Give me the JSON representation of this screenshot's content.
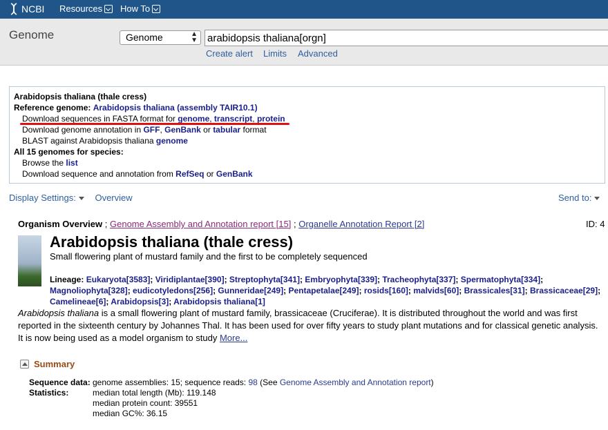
{
  "topbar": {
    "logo_text": "NCBI",
    "resources": "Resources",
    "howto": "How To"
  },
  "search": {
    "db_title": "Genome",
    "db_select": "Genome",
    "query": "arabidopsis thaliana[orgn]",
    "create_alert": "Create alert",
    "limits": "Limits",
    "advanced": "Advanced"
  },
  "refbox": {
    "title": "Arabidopsis thaliana (thale cress)",
    "ref_label": "Reference genome:",
    "ref_link": "Arabidopsis thaliana (assembly TAIR10.1)",
    "fasta_prefix": "Download sequences in FASTA format for",
    "fasta_genome": "genome",
    "fasta_transcript": "transcript",
    "fasta_protein": "protein",
    "annot_prefix": "Download genome annotation in",
    "annot_gff": "GFF",
    "annot_genbank": "GenBank",
    "annot_or": "or",
    "annot_tabular": "tabular",
    "annot_suffix": "format",
    "blast_prefix": "BLAST against Arabidopsis thaliana",
    "blast_link": "genome",
    "all_label": "All 15 genomes for species:",
    "browse_prefix": "Browse the",
    "browse_link": "list",
    "dl_prefix": "Download sequence and annotation from",
    "dl_refseq": "RefSeq",
    "dl_or": "or",
    "dl_genbank": "GenBank"
  },
  "display": {
    "settings": "Display Settings:",
    "overview": "Overview",
    "sendto": "Send to:"
  },
  "overview": {
    "label": "Organism Overview",
    "sep1": ";",
    "assembly_report": "Genome Assembly and Annotation report [15]",
    "sep2": ";",
    "organelle_report": "Organelle Annotation Report [2]",
    "id": "ID: 4",
    "title": "Arabidopsis thaliana (thale cress)",
    "subtitle": "Small flowering plant of mustard family and the first to be completely sequenced",
    "lineage_label": "Lineage:",
    "lineage": [
      "Eukaryota[3583]",
      "Viridiplantae[390]",
      "Streptophyta[341]",
      "Embryophyta[339]",
      "Tracheophyta[337]",
      "Spermatophyta[334]",
      "Magnoliophyta[328]",
      "eudicotyledons[256]",
      "Gunneridae[249]",
      "Pentapetalae[249]",
      "rosids[160]",
      "malvids[60]",
      "Brassicales[31]",
      "Brassicaceae[29]",
      "Camelineae[6]",
      "Arabidopsis[3]",
      "Arabidopsis thaliana[1]"
    ],
    "desc_italic": "Arabidopsis thaliana",
    "desc_text": " is a small flowering plant of mustard family, brassicaceae (Cruciferae). It is distributed throughout the world and was first reported in the sixteenth century by Johannes Thal. It has been used for over fifty years to study plant mutations and for classical genetic analysis. It is now being used as a model organism to study ",
    "more": "More..."
  },
  "summary": {
    "heading": "Summary",
    "seq_label": "Sequence data:",
    "seq_text": "genome assemblies: 15; sequence reads: ",
    "seq_reads": "98",
    "seq_see": " (See ",
    "seq_link": "Genome Assembly and Annotation report",
    "seq_close": ")",
    "stats_label": "Statistics:",
    "stat1": "median total length (Mb): 119.148",
    "stat2": "median protein count: 39551",
    "stat3": "median GC%: 36.15"
  }
}
